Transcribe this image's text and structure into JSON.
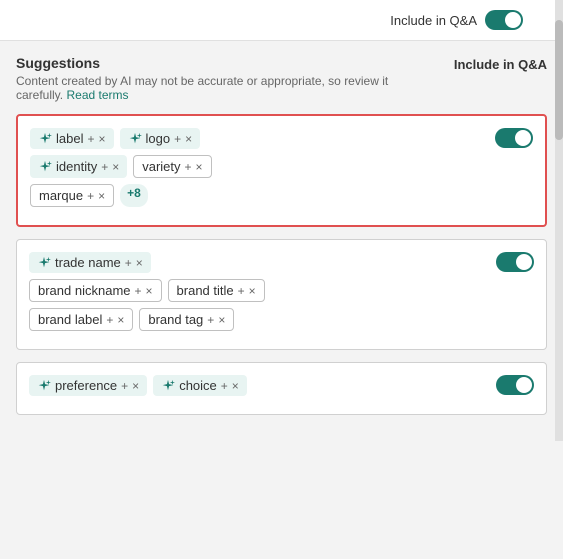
{
  "topBar": {
    "toggleLabel": "Include in Q&A",
    "toggle": true
  },
  "suggestions": {
    "heading": "Suggestions",
    "description": "Content created by AI may not be accurate or appropriate, so review it carefully.",
    "linkText": "Read terms",
    "columnLabel": "Include in Q&A"
  },
  "cards": [
    {
      "id": "card1",
      "selected": true,
      "toggle": true,
      "rows": [
        [
          {
            "type": "ai",
            "text": "label"
          },
          {
            "type": "ai",
            "text": "logo"
          }
        ],
        [
          {
            "type": "ai",
            "text": "identity"
          },
          {
            "type": "plain",
            "text": "variety"
          }
        ],
        [
          {
            "type": "plain",
            "text": "marque"
          },
          {
            "type": "badge",
            "text": "+8"
          }
        ]
      ]
    },
    {
      "id": "card2",
      "selected": false,
      "toggle": true,
      "rows": [
        [
          {
            "type": "ai",
            "text": "trade name"
          }
        ],
        [
          {
            "type": "plain",
            "text": "brand nickname"
          },
          {
            "type": "plain",
            "text": "brand title"
          }
        ],
        [
          {
            "type": "plain",
            "text": "brand label"
          },
          {
            "type": "plain",
            "text": "brand tag"
          }
        ]
      ]
    },
    {
      "id": "card3",
      "selected": false,
      "toggle": true,
      "rows": [
        [
          {
            "type": "ai",
            "text": "preference"
          },
          {
            "type": "ai",
            "text": "choice"
          }
        ]
      ]
    }
  ]
}
